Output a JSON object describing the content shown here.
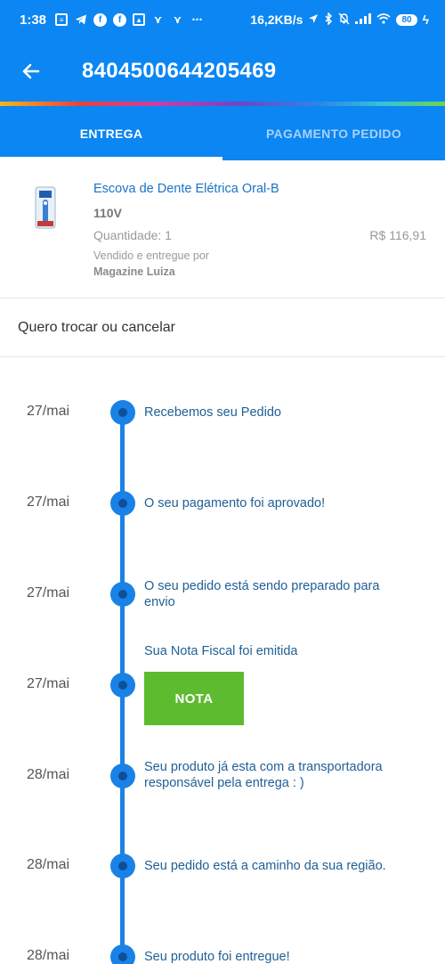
{
  "status_bar": {
    "time": "1:38",
    "network_speed": "16,2KB/s",
    "battery": "80",
    "icons_left": [
      "news-icon",
      "telegram-icon",
      "facebook-icon",
      "facebook-icon",
      "image-icon",
      "bird-icon",
      "bird-icon",
      "more-icon"
    ],
    "icons_right": [
      "location-icon",
      "bluetooth-icon",
      "mute-icon",
      "signal-icon",
      "wifi-icon",
      "battery-icon",
      "charging-icon"
    ]
  },
  "header": {
    "title": "8404500644205469",
    "back_icon": "arrow-left-icon"
  },
  "tabs": [
    {
      "label": "ENTREGA",
      "active": true
    },
    {
      "label": "PAGAMENTO PEDIDO",
      "active": false
    }
  ],
  "product": {
    "name": "Escova de Dente Elétrica Oral-B",
    "variant": "110V",
    "quantity": "Quantidade: 1",
    "price": "R$ 116,91",
    "sold_by_label": "Vendido e entregue por",
    "seller": "Magazine Luiza"
  },
  "exchange_link": "Quero trocar ou cancelar",
  "timeline": [
    {
      "date": "27/mai",
      "text": "Recebemos seu Pedido"
    },
    {
      "date": "27/mai",
      "text": "O seu pagamento foi aprovado!"
    },
    {
      "date": "27/mai",
      "text": "O seu pedido está sendo preparado para envio"
    },
    {
      "date": "27/mai",
      "text": "Sua Nota Fiscal foi emitida",
      "button": "NOTA"
    },
    {
      "date": "28/mai",
      "text": "Seu produto já esta com a transportadora responsável pela entrega : )"
    },
    {
      "date": "28/mai",
      "text": "Seu pedido está a caminho da sua região."
    },
    {
      "date": "28/mai",
      "text": "Seu produto foi entregue!"
    }
  ],
  "colors": {
    "primary": "#0b86f2",
    "timeline": "#1a82e6",
    "nota_button": "#5dbb2f",
    "link_text": "#1a73c7"
  }
}
